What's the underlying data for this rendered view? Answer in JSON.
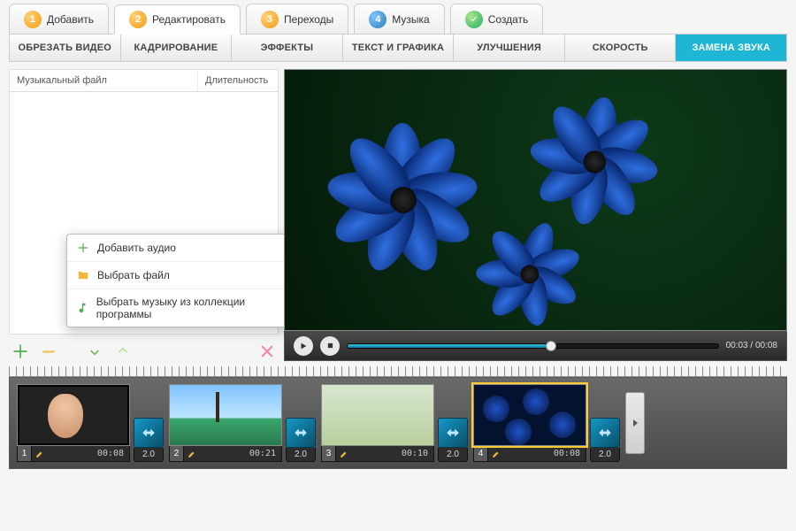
{
  "wizard": {
    "steps": [
      {
        "num": "1",
        "label": "Добавить"
      },
      {
        "num": "2",
        "label": "Редактировать"
      },
      {
        "num": "3",
        "label": "Переходы"
      },
      {
        "num": "4",
        "label": "Музыка"
      },
      {
        "check": true,
        "label": "Создать"
      }
    ],
    "active": 1
  },
  "tooltabs": {
    "items": [
      "ОБРЕЗАТЬ ВИДЕО",
      "КАДРИРОВАНИЕ",
      "ЭФФЕКТЫ",
      "ТЕКСТ И ГРАФИКА",
      "УЛУЧШЕНИЯ",
      "СКОРОСТЬ",
      "ЗАМЕНА ЗВУКА"
    ],
    "active": 6
  },
  "audio_panel": {
    "col_file": "Музыкальный файл",
    "col_duration": "Длительность"
  },
  "menu": {
    "add_audio": "Добавить аудио",
    "choose_file": "Выбрать файл",
    "choose_library": "Выбрать музыку из коллекции программы"
  },
  "player": {
    "current": "00:03",
    "total": "00:08",
    "sep": " / "
  },
  "timeline": {
    "transition_duration": "2.0",
    "clips": [
      {
        "num": "1",
        "time": "00:08"
      },
      {
        "num": "2",
        "time": "00:21"
      },
      {
        "num": "3",
        "time": "00:10"
      },
      {
        "num": "4",
        "time": "00:08"
      }
    ]
  },
  "icons": {
    "plus": "plus-icon",
    "minus": "minus-icon",
    "down": "arrow-down-icon",
    "up": "arrow-up-icon",
    "delete": "delete-icon",
    "play": "play-icon",
    "stop": "stop-icon",
    "folder": "folder-icon",
    "music": "music-note-icon",
    "pencil": "pencil-icon",
    "next": "chevron-right-icon"
  },
  "colors": {
    "accent": "#1fb6d6",
    "badge_orange": "#f39c12",
    "badge_blue": "#2980b9",
    "badge_green": "#27ae60"
  }
}
